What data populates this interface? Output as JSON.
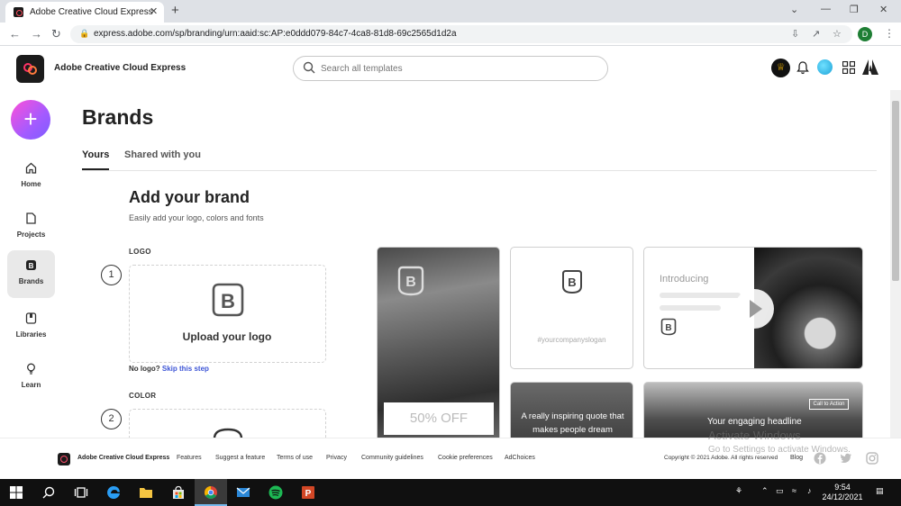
{
  "browser": {
    "tab_title": "Adobe Creative Cloud Express",
    "tab_close": "✕",
    "new_tab": "+",
    "url": "express.adobe.com/sp/branding/urn:aaid:sc:AP:e0ddd079-84c7-4ca8-81d8-69c2565d1d2a",
    "profile_initial": "D",
    "window_controls": {
      "minimize": "—",
      "maximize": "❐",
      "close": "✕",
      "dropdown": "⌄"
    }
  },
  "header": {
    "app_name": "Adobe Creative Cloud Express",
    "search_placeholder": "Search all templates"
  },
  "rail": {
    "create_label": "+",
    "items": [
      {
        "label": "Home",
        "icon": "home-icon"
      },
      {
        "label": "Projects",
        "icon": "file-icon"
      },
      {
        "label": "Brands",
        "icon": "brand-b-icon",
        "active": true
      },
      {
        "label": "Libraries",
        "icon": "library-icon"
      },
      {
        "label": "Learn",
        "icon": "lightbulb-icon"
      }
    ]
  },
  "main": {
    "title": "Brands",
    "tabs": [
      {
        "label": "Yours",
        "active": true
      },
      {
        "label": "Shared with you"
      }
    ],
    "add_title": "Add your brand",
    "add_subtitle": "Easily add your logo, colors and fonts",
    "logo_label": "LOGO",
    "color_label": "COLOR",
    "step1": "1",
    "step2": "2",
    "upload_label": "Upload your logo",
    "no_logo": "No logo?",
    "skip": "Skip this step"
  },
  "previews": {
    "offer": "50% OFF",
    "slogan": "#yourcompanyslogan",
    "introducing": "Introducing",
    "quote": "A really inspiring quote that makes people dream",
    "cta": "Call to Action",
    "headline": "Your engaging headline"
  },
  "footer": {
    "name": "Adobe Creative Cloud Express",
    "links": [
      "Features",
      "Suggest a feature",
      "Terms of use",
      "Privacy",
      "Community guidelines",
      "Cookie preferences",
      "AdChoices"
    ],
    "copyright": "Copyright © 2021 Adobe. All rights reserved",
    "blog": "Blog"
  },
  "watermark": {
    "line1": "Activate Windows",
    "line2": "Go to Settings to activate Windows."
  },
  "taskbar": {
    "time": "9:54",
    "date": "24/12/2021"
  },
  "colors": {
    "accent_link": "#3d55d6",
    "create_gradient": [
      "#ff4fd8",
      "#7d5cff"
    ],
    "premium_crown": "#f3b400"
  }
}
